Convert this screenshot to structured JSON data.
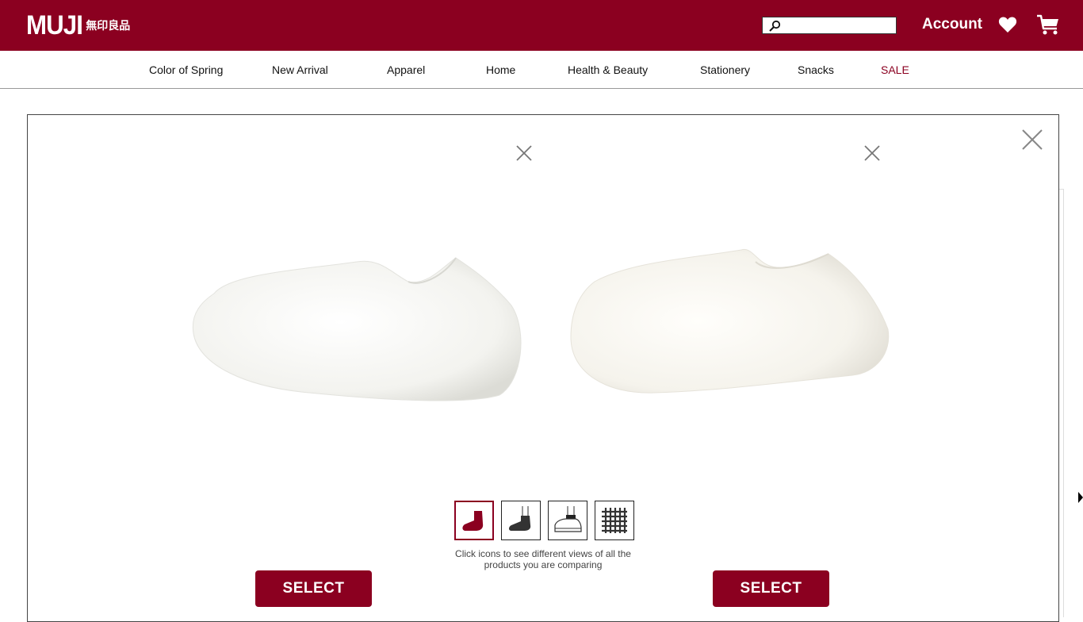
{
  "brand": {
    "logo_main": "MUJI",
    "logo_sub": "無印良品"
  },
  "header": {
    "search_placeholder": "",
    "account_label": "Account"
  },
  "nav": {
    "items": [
      {
        "label": "Color of Spring"
      },
      {
        "label": "New Arrival"
      },
      {
        "label": "Apparel"
      },
      {
        "label": "Home"
      },
      {
        "label": "Health & Beauty"
      },
      {
        "label": "Stationery"
      },
      {
        "label": "Snacks"
      },
      {
        "label": "SALE"
      }
    ]
  },
  "compare": {
    "hint": "Click icons to see different views of all the products you are comparing",
    "select_left": "SELECT",
    "select_right": "SELECT",
    "views": [
      "sock-icon",
      "foot-sock-icon",
      "shoe-sock-icon",
      "fabric-texture-icon"
    ]
  },
  "colors": {
    "brand": "#8b0020",
    "text": "#111111"
  }
}
